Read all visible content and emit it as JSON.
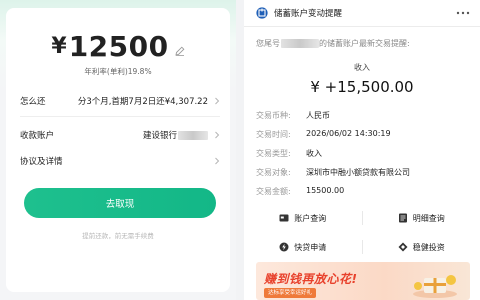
{
  "loan": {
    "currency": "¥",
    "amount": "12500",
    "rate_label": "年利率(单利)19.8%",
    "repay_label": "怎么还",
    "repay_value": "分3个月,首期7月2日还¥4,307.22",
    "account_label": "收款账户",
    "account_value": "建设银行",
    "agreement_label": "协议及详情",
    "withdraw_button": "去取现",
    "footnote": "提前还款，前无需手续费"
  },
  "notice": {
    "title": "储蓄账户变动提醒",
    "intro_prefix": "您尾号",
    "intro_suffix": "的储蓄账户最新交易提醒:",
    "type": "收入",
    "amount": "¥ +15,500.00",
    "details": [
      {
        "key": "交易币种:",
        "value": "人民币"
      },
      {
        "key": "交易时间:",
        "value": "2026/06/02 14:30:19"
      },
      {
        "key": "交易类型:",
        "value": "收入"
      },
      {
        "key": "交易对象:",
        "value": "深圳市中融小额贷款有限公司"
      },
      {
        "key": "交易金额:",
        "value": "15500.00"
      }
    ],
    "actions": [
      "账户查询",
      "明细查询",
      "快贷申请",
      "稳健投资"
    ],
    "banner_slogan": "赚到钱再放心花!",
    "banner_sub": "达标享受幸运好礼"
  },
  "colors": {
    "accent_green": "#19bb8a",
    "banner_red": "#e8412c"
  },
  "icons": {
    "edit": "pencil-icon",
    "chevron": "chevron-right-icon",
    "bank": "bank-logo-icon",
    "more": "more-dots-icon"
  }
}
